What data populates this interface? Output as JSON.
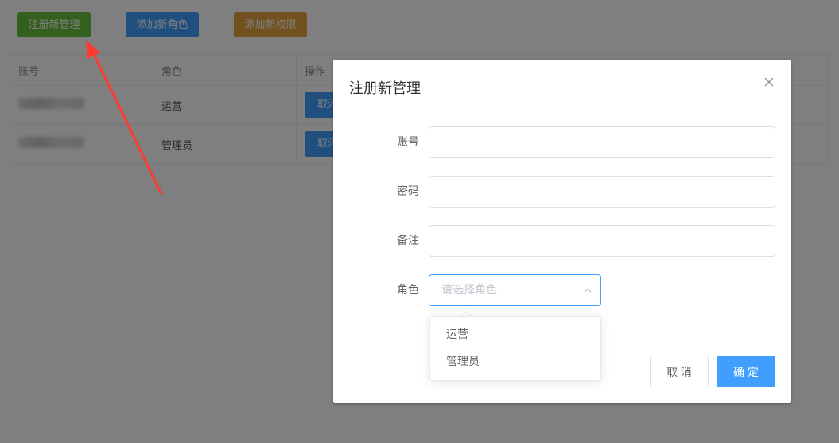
{
  "toolbar": {
    "register_admin": "注册新管理",
    "add_role": "添加新角色",
    "add_permission": "添加新权限"
  },
  "table": {
    "headers": [
      "账号",
      "角色",
      "操作"
    ],
    "rows": [
      {
        "role": "运营",
        "action": "取消"
      },
      {
        "role": "管理员",
        "action": "取消"
      }
    ]
  },
  "dialog": {
    "title": "注册新管理",
    "close_icon": "close-icon",
    "fields": {
      "account_label": "账号",
      "password_label": "密码",
      "remark_label": "备注",
      "role_label": "角色",
      "role_placeholder": "请选择角色"
    },
    "dropdown_options": [
      "运营",
      "管理员"
    ],
    "cancel_label": "取 消",
    "ok_label": "确 定"
  },
  "colors": {
    "primary": "#409eff",
    "success": "#67c23a",
    "warning": "#e6a23c",
    "annotation_arrow": "#ff3b30"
  }
}
